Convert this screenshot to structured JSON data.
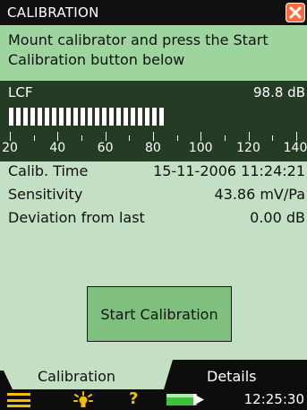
{
  "titlebar": {
    "title": "CALIBRATION"
  },
  "instruction": "Mount calibrator and press the Start Calibration button below",
  "meter": {
    "label": "LCF",
    "value": "98.8 dB",
    "level_db": 98.8,
    "scale": [
      "20",
      "40",
      "60",
      "80",
      "100",
      "120",
      "140"
    ]
  },
  "rows": [
    {
      "key": "Calib. Time",
      "value": "15-11-2006 11:24:21"
    },
    {
      "key": "Sensitivity",
      "value": "43.86 mV/Pa"
    },
    {
      "key": "Deviation from last",
      "value": "0.00 dB"
    }
  ],
  "start_button": "Start Calibration",
  "tabs": [
    {
      "label": "Calibration",
      "active": true
    },
    {
      "label": "Details",
      "active": false
    }
  ],
  "status": {
    "clock": "12:25:30"
  },
  "icons": {
    "close": "close-icon",
    "menu": "menu-icon",
    "backlight": "backlight-bulb-icon",
    "help": "help-icon",
    "battery": "battery-icon"
  },
  "colors": {
    "background": "#c4e0c4",
    "instruction": "#9ed49e",
    "meter": "#243c24",
    "button": "#7fc07f",
    "accent": "#f0c000",
    "close": "#ff6a3a"
  }
}
